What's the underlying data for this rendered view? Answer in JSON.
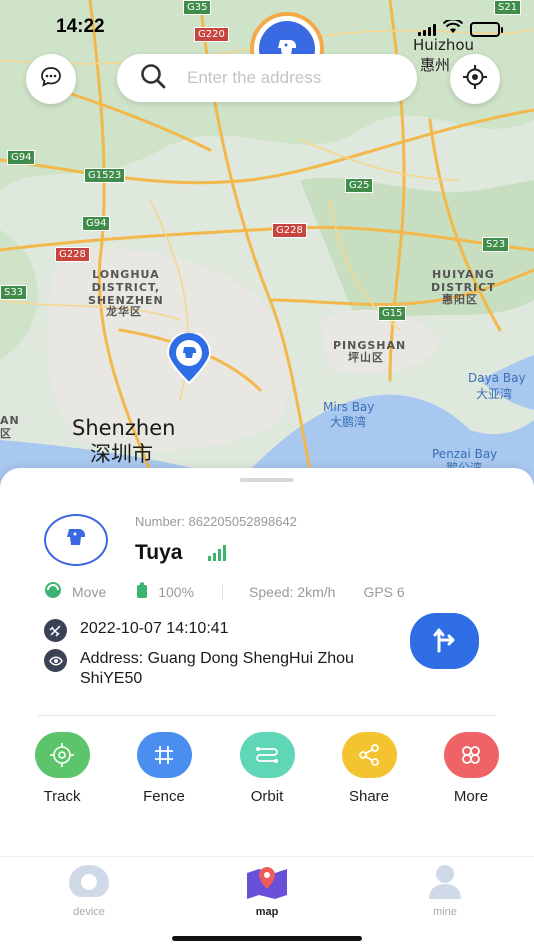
{
  "status_bar": {
    "time": "14:22"
  },
  "map": {
    "labels": {
      "longhua": "LONGHUA\nDISTRICT,\nSHENZHEN",
      "longhua_cn": "龙华区",
      "huiyang": "HUIYANG\nDISTRICT",
      "huiyang_cn": "惠阳区",
      "pingshan": "PINGSHAN",
      "pingshan_cn": "坪山区",
      "mirs_bay": "Mirs Bay",
      "mirs_bay_cn": "大鹏湾",
      "daya_bay": "Daya Bay",
      "daya_bay_cn": "大亚湾",
      "penzai_bay": "Penzai Bay",
      "penzai_bay_cn": "鹅公湾",
      "huizhou": "Huizhou",
      "huizhou_cn": "惠州",
      "shenzhen": "Shenzhen",
      "shenzhen_cn": "深圳市",
      "an": "AN",
      "an_cn": "区"
    },
    "roads": {
      "g35": "G35",
      "g220": "G220",
      "s21": "S21",
      "g94_left": "G94",
      "g1523": "G1523",
      "g25": "G25",
      "g94": "G94",
      "g228_mid": "G228",
      "g228_left": "G228",
      "s23": "S23",
      "s33": "S33",
      "g15": "G15"
    }
  },
  "search": {
    "placeholder": "Enter the address"
  },
  "device": {
    "number": "Number: 862205052898642",
    "name": "Tuya",
    "status": "Move",
    "battery": "100%",
    "speed": "Speed: 2km/h",
    "gps": "GPS 6",
    "datetime": "2022-10-07 14:10:41",
    "address": "Address: Guang Dong ShengHui Zhou ShiYE50"
  },
  "actions": [
    {
      "label": "Track",
      "color": "#5cc46a"
    },
    {
      "label": "Fence",
      "color": "#4a8ef0"
    },
    {
      "label": "Orbit",
      "color": "#5fd6b6"
    },
    {
      "label": "Share",
      "color": "#f4c430"
    },
    {
      "label": "More",
      "color": "#ef6266"
    }
  ],
  "tabs": [
    {
      "label": "device",
      "active": false
    },
    {
      "label": "map",
      "active": true
    },
    {
      "label": "mine",
      "active": false
    }
  ],
  "colors": {
    "accent": "#2f6de4",
    "signal_green": "#3cb371"
  }
}
